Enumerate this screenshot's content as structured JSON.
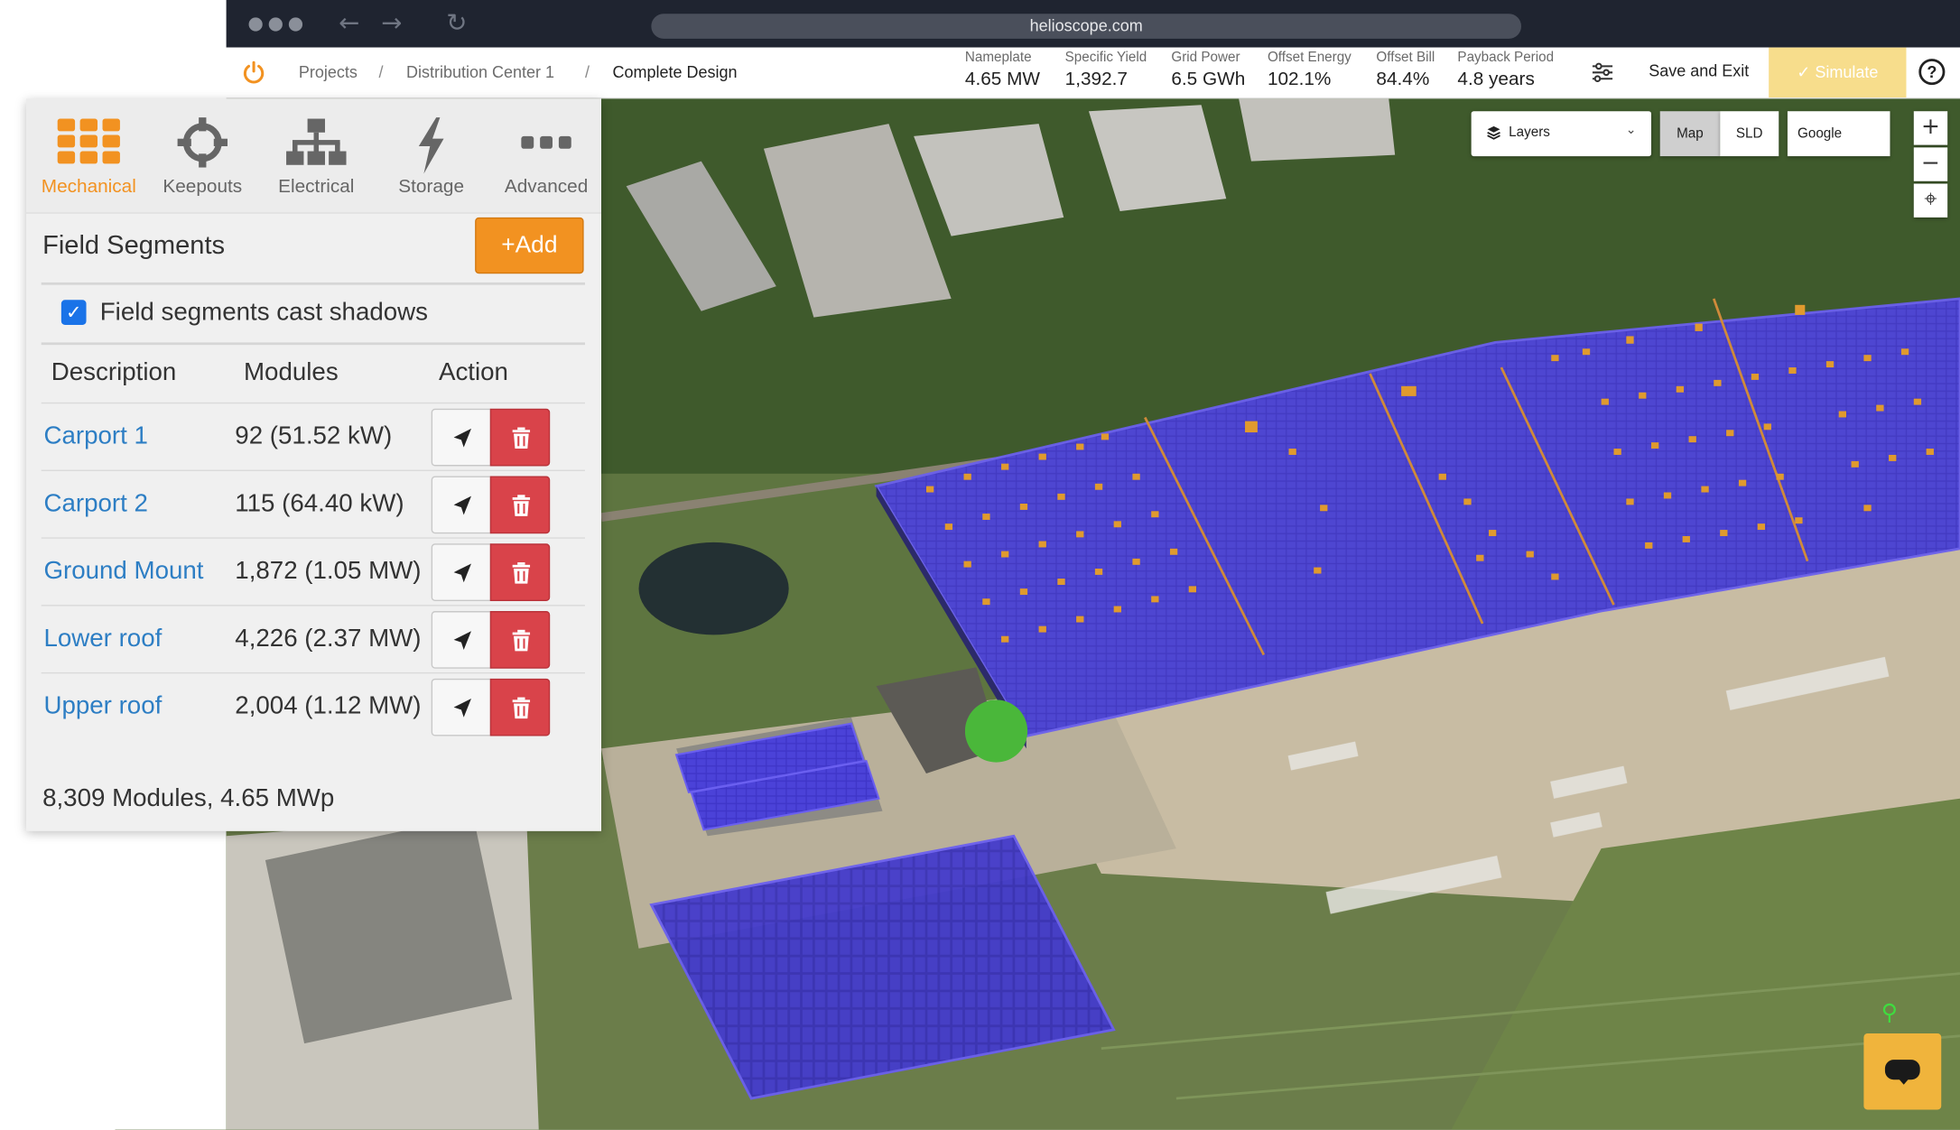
{
  "browser": {
    "url": "helioscope.com"
  },
  "breadcrumb": {
    "projects": "Projects",
    "project": "Distribution Center 1",
    "design": "Complete Design",
    "sep": "/"
  },
  "metrics": [
    {
      "label": "Nameplate",
      "value": "4.65 MW"
    },
    {
      "label": "Specific Yield",
      "value": "1,392.7"
    },
    {
      "label": "Grid Power",
      "value": "6.5 GWh"
    },
    {
      "label": "Offset Energy",
      "value": "102.1%"
    },
    {
      "label": "Offset Bill",
      "value": "84.4%"
    },
    {
      "label": "Payback Period",
      "value": "4.8 years"
    }
  ],
  "actions": {
    "save_exit": "Save and Exit",
    "simulate": "Simulate",
    "help": "?"
  },
  "tabs": [
    {
      "label": "Mechanical",
      "icon": "grid-icon",
      "active": true
    },
    {
      "label": "Keepouts",
      "icon": "crosshair-icon",
      "active": false
    },
    {
      "label": "Electrical",
      "icon": "hierarchy-icon",
      "active": false
    },
    {
      "label": "Storage",
      "icon": "lightning-icon",
      "active": false
    },
    {
      "label": "Advanced",
      "icon": "more-icon",
      "active": false
    }
  ],
  "field_segments": {
    "title": "Field Segments",
    "add_label": "Add",
    "cast_shadows_label": "Field segments cast shadows",
    "cast_shadows_checked": true,
    "columns": [
      "Description",
      "Modules",
      "Action"
    ],
    "rows": [
      {
        "description": "Carport 1",
        "modules": "92 (51.52 kW)"
      },
      {
        "description": "Carport 2",
        "modules": "115 (64.40 kW)"
      },
      {
        "description": "Ground Mount",
        "modules": "1,872 (1.05 MW)"
      },
      {
        "description": "Lower roof",
        "modules": "4,226 (2.37 MW)"
      },
      {
        "description": "Upper roof",
        "modules": "2,004 (1.12 MW)"
      }
    ],
    "totals": "8,309 Modules, 4.65 MWp"
  },
  "map_controls": {
    "layers_label": "Layers",
    "map_label": "Map",
    "sld_label": "SLD",
    "basemap_label": "Google",
    "zoom_in": "+",
    "zoom_out": "−",
    "locate": "⌖"
  },
  "colors": {
    "accent": "#f29221",
    "delete": "#d9434a",
    "link": "#2d7ec4",
    "array_fill": "#4a3fd6",
    "simulate_bg": "#f7dd8c"
  }
}
